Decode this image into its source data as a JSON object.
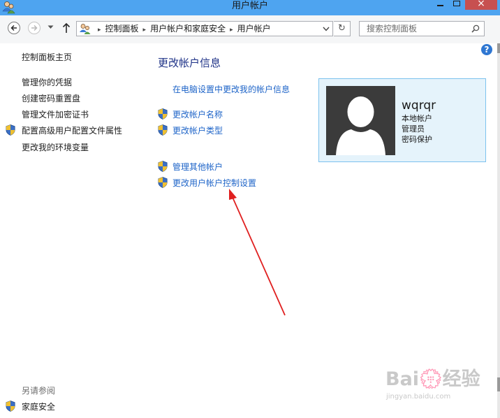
{
  "window": {
    "title": "用户帐户",
    "close_glyph": "×"
  },
  "address_bar": {
    "breadcrumbs": [
      "控制面板",
      "用户帐户和家庭安全",
      "用户帐户"
    ],
    "separator": "▸",
    "search_placeholder": "搜索控制面板"
  },
  "help": {
    "glyph": "?"
  },
  "left_pane": {
    "home": "控制面板主页",
    "links": [
      "管理你的凭据",
      "创建密码重置盘",
      "管理文件加密证书",
      "配置高级用户配置文件属性",
      "更改我的环境变量"
    ],
    "see_also_title": "另请参阅",
    "see_also_link": "家庭安全"
  },
  "main": {
    "heading": "更改帐户信息",
    "pc_settings_link": "在电脑设置中更改我的帐户信息",
    "tasks": [
      "更改帐户名称",
      "更改帐户类型"
    ],
    "other_tasks": [
      "管理其他帐户",
      "更改用户帐户控制设置"
    ]
  },
  "account": {
    "name": "wqrqr",
    "type": "本地帐户",
    "role": "管理员",
    "protection": "密码保护"
  },
  "watermark": {
    "logo": "Bai💮经验",
    "url": "jingyan.baidu.com"
  },
  "colors": {
    "titlebar": "#4ea4f0",
    "link": "#1e64c8",
    "heading": "#1e3287",
    "card_bg": "#e5f3fb",
    "card_border": "#7dc2ee",
    "arrow": "#e02020",
    "close_button": "#c75050"
  }
}
